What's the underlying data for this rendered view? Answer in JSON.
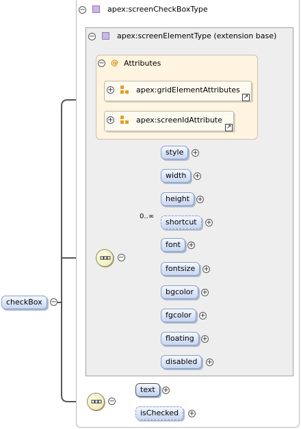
{
  "outer_type": {
    "label": "apex:screenCheckBoxType"
  },
  "inner_type": {
    "label": "apex:screenElementType (extension base)"
  },
  "attributes_group": {
    "label": "Attributes",
    "items": [
      {
        "label": "apex:gridElementAttributes"
      },
      {
        "label": "apex:screenIdAttribute"
      }
    ]
  },
  "root_element": {
    "label": "checkBox"
  },
  "inner_sequence": {
    "elements": [
      {
        "label": "style"
      },
      {
        "label": "width"
      },
      {
        "label": "height"
      },
      {
        "label": "shortcut",
        "cardinality": "0..∞"
      },
      {
        "label": "font"
      },
      {
        "label": "fontsize"
      },
      {
        "label": "bgcolor"
      },
      {
        "label": "fgcolor"
      },
      {
        "label": "floating"
      },
      {
        "label": "disabled"
      }
    ]
  },
  "outer_sequence": {
    "elements": [
      {
        "label": "text"
      },
      {
        "label": "isChecked"
      }
    ]
  },
  "symbols": {
    "collapse": "−",
    "expand": "+",
    "attr_at": "@",
    "link": "↗"
  },
  "colors": {
    "attr_bg": "#fff4df",
    "elem_grad_end": "#c8d6f0",
    "inner_bg": "#eeeeee"
  }
}
